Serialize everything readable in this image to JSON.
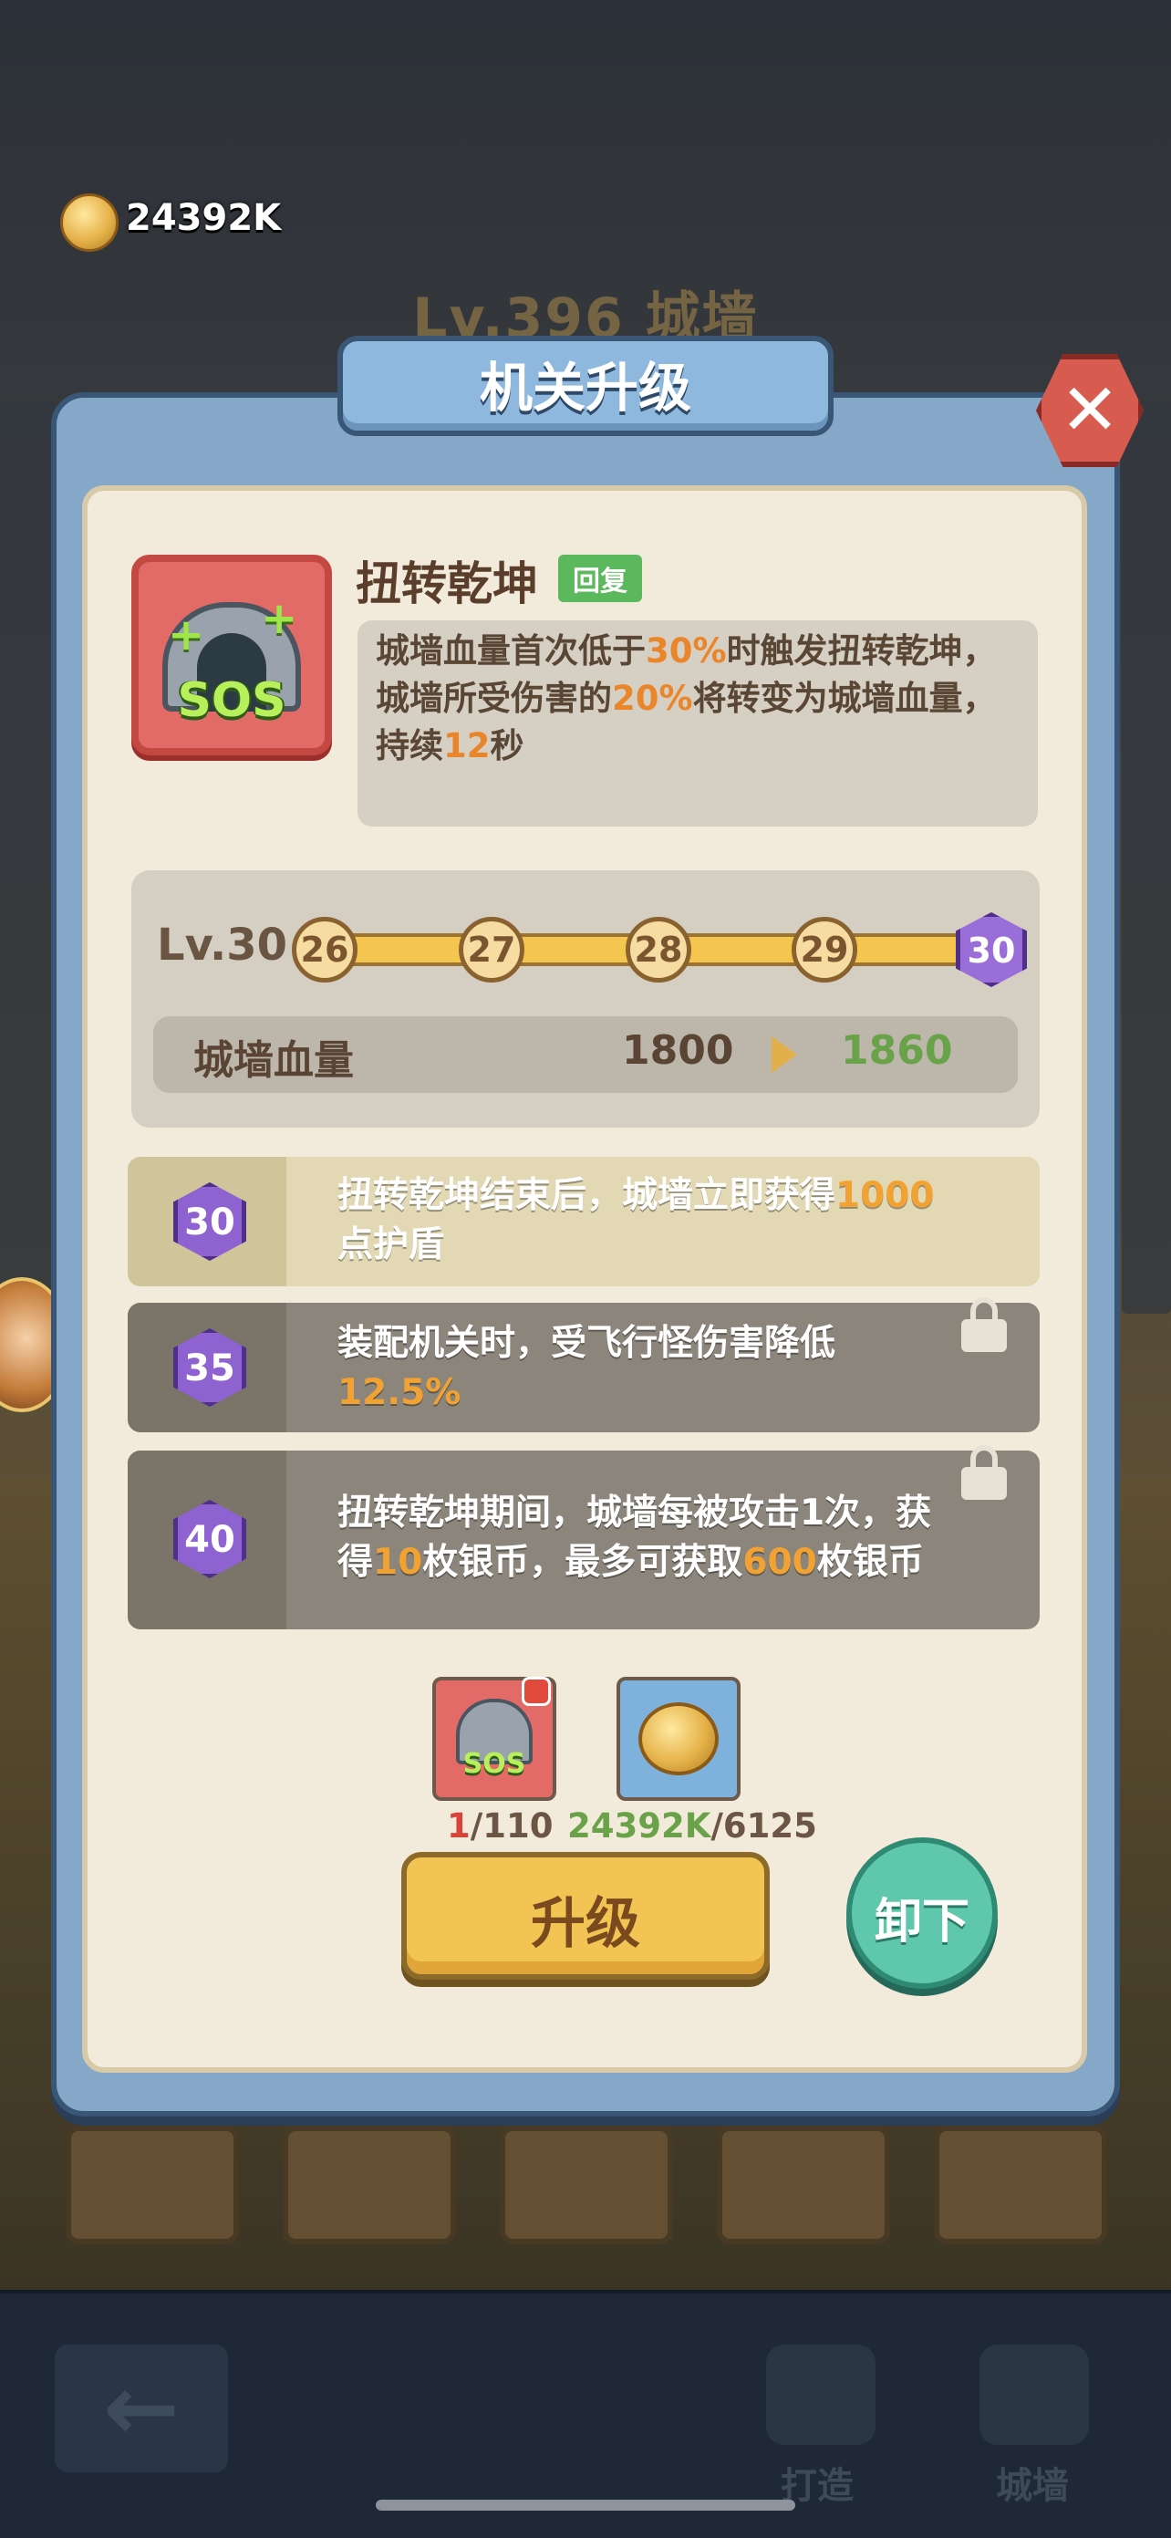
{
  "hud": {
    "coins": "24392K"
  },
  "background": {
    "level_title": "Lv.396 城墙"
  },
  "dialog": {
    "title": "机关升级",
    "skill": {
      "name": "扭转乾坤",
      "tag": "回复",
      "desc_parts": [
        "城墙血量首次低于",
        "30%",
        "时触发扭转乾坤，城墙所受伤害的",
        "20%",
        "将转变为城墙血量，持续",
        "12",
        "秒"
      ]
    },
    "level": {
      "label": "Lv.30",
      "nodes": [
        "26",
        "27",
        "28",
        "29",
        "30"
      ],
      "stat_name": "城墙血量",
      "stat_old": "1800",
      "stat_new": "1860"
    },
    "effects": [
      {
        "level": "30",
        "unlocked": true,
        "text_parts": [
          "扭转乾坤结束后，城墙立即获得",
          "1000",
          "点护盾"
        ]
      },
      {
        "level": "35",
        "unlocked": false,
        "text_parts": [
          "装配机关时，受飞行怪伤害降低",
          "12.5%",
          ""
        ]
      },
      {
        "level": "40",
        "unlocked": false,
        "text_parts": [
          "扭转乾坤期间，城墙每被攻击1次，获得",
          "10",
          "枚银币，最多可获取",
          "600",
          "枚银币"
        ]
      }
    ],
    "cost": {
      "pieces_have": "1",
      "pieces_need": "/110",
      "coins_have": "24392K",
      "coins_need": "/6125"
    },
    "upgrade_label": "升级",
    "unequip_label": "卸下"
  },
  "nav": {
    "craft": "打造",
    "wall": "城墙"
  },
  "colors": {
    "highlight": "#e9862b",
    "stat_new": "#6aa24a",
    "unlock_hex": "#8e62d0"
  }
}
